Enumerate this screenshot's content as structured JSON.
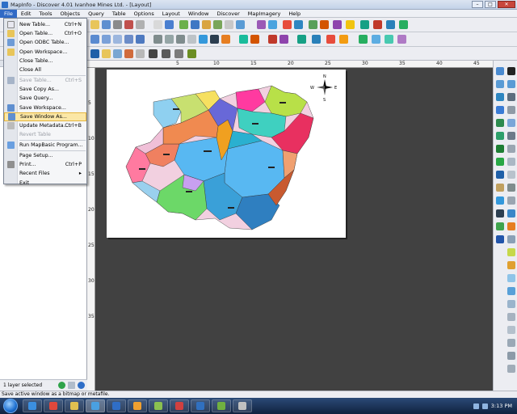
{
  "window": {
    "title": "MapInfo - Discover 4.01 Ivanhoe Mines Ltd. - [Layout]",
    "controls": [
      "–",
      "□",
      "✕"
    ]
  },
  "menubar": {
    "items": [
      "File",
      "Edit",
      "Tools",
      "Objects",
      "Query",
      "Table",
      "Options",
      "Layout",
      "Window",
      "Discover",
      "MapImagery",
      "Help"
    ],
    "active": "File"
  },
  "file_menu": {
    "items": [
      {
        "label": "New Table...",
        "shortcut": "Ctrl+N",
        "enabled": true,
        "icon_color": "#e8e8f0"
      },
      {
        "label": "Open Table...",
        "shortcut": "Ctrl+O",
        "enabled": true,
        "icon_color": "#e8c55a"
      },
      {
        "label": "Open ODBC Table...",
        "shortcut": "",
        "enabled": true,
        "icon_color": "#6e9bd6"
      },
      {
        "label": "Open Workspace...",
        "shortcut": "",
        "enabled": true,
        "icon_color": "#e8c55a"
      },
      {
        "label": "Close Table...",
        "shortcut": "",
        "enabled": true,
        "icon_color": ""
      },
      {
        "label": "Close All",
        "shortcut": "",
        "enabled": true,
        "icon_color": ""
      },
      {
        "label": "Save Table...",
        "shortcut": "Ctrl+S",
        "enabled": false,
        "icon_color": "#a6b4c8"
      },
      {
        "label": "Save Copy As...",
        "shortcut": "",
        "enabled": true,
        "icon_color": ""
      },
      {
        "label": "Save Query...",
        "shortcut": "",
        "enabled": true,
        "icon_color": ""
      },
      {
        "label": "Save Workspace...",
        "shortcut": "",
        "enabled": true,
        "icon_color": "#5f8fd0"
      },
      {
        "label": "Save Window As...",
        "shortcut": "",
        "enabled": true,
        "highlighted": true,
        "icon_color": "#5f8fd0"
      },
      {
        "label": "Update Metadata...",
        "shortcut": "Ctrl+B",
        "enabled": true,
        "icon_color": "#bbbbbb"
      },
      {
        "label": "Revert Table",
        "shortcut": "",
        "enabled": false,
        "icon_color": ""
      },
      {
        "label": "Run MapBasic Program...",
        "shortcut": "",
        "enabled": true,
        "icon_color": "#6a9fe0"
      },
      {
        "label": "Page Setup...",
        "shortcut": "",
        "enabled": true,
        "icon_color": ""
      },
      {
        "label": "Print...",
        "shortcut": "Ctrl+P",
        "enabled": true,
        "icon_color": "#8f8f8f"
      },
      {
        "label": "Recent Files",
        "shortcut": "▸",
        "enabled": true,
        "icon_color": ""
      },
      {
        "label": "Exit",
        "shortcut": "",
        "enabled": true,
        "icon_color": ""
      }
    ]
  },
  "layout": {
    "ruler_top_labels": [
      "5",
      "10",
      "15",
      "20",
      "25",
      "30",
      "35",
      "40",
      "45"
    ],
    "ruler_left_labels": [
      "5",
      "10",
      "15",
      "20",
      "25",
      "30",
      "35"
    ],
    "page_color": "#ffffff",
    "canvas_color": "#414141",
    "compass_labels": {
      "n": "N",
      "s": "S",
      "e": "E",
      "w": "W"
    }
  },
  "left_panel": {
    "footer_text": "1 layer selected"
  },
  "statusbar": {
    "text": "Save active window as a bitmap or metafile."
  },
  "taskbar": {
    "clock": "3:13 PM"
  }
}
